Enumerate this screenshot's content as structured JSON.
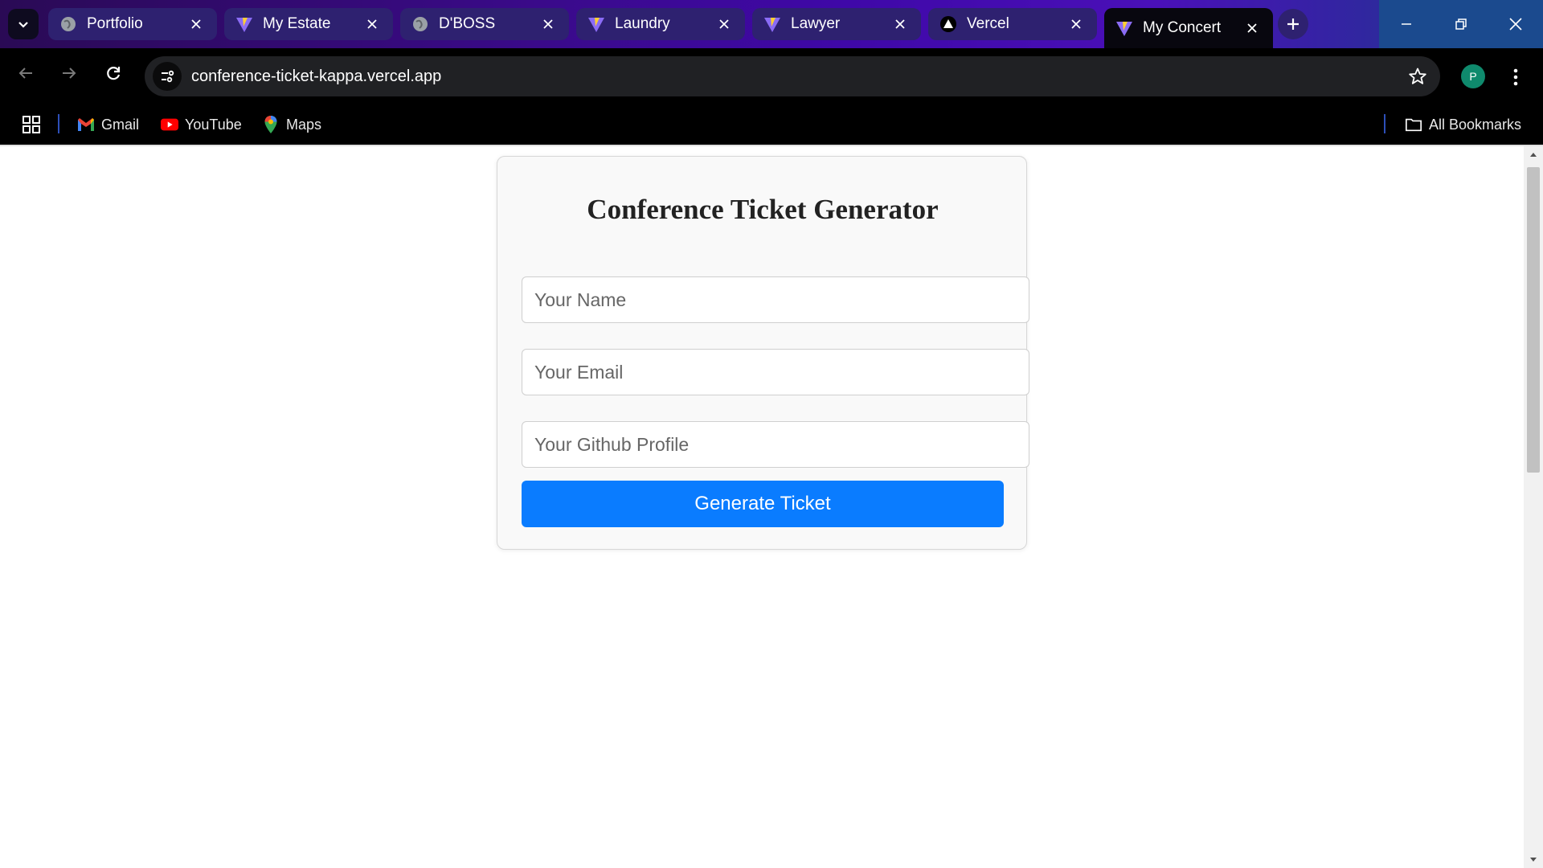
{
  "browser": {
    "tabs": [
      {
        "title": "Portfolio",
        "icon": "globe-icon",
        "active": false
      },
      {
        "title": "My Estate",
        "icon": "vite-icon",
        "active": false
      },
      {
        "title": "D'BOSS",
        "icon": "globe-icon",
        "active": false
      },
      {
        "title": "Laundry",
        "icon": "vite-icon",
        "active": false
      },
      {
        "title": "Lawyer",
        "icon": "vite-icon",
        "active": false
      },
      {
        "title": "Vercel",
        "icon": "vercel-icon",
        "active": false
      },
      {
        "title": "My Concert",
        "icon": "vite-icon",
        "active": true
      }
    ],
    "url": "conference-ticket-kappa.vercel.app",
    "profile_initial": "P",
    "bookmarks": [
      {
        "label": "Gmail",
        "icon": "gmail-icon"
      },
      {
        "label": "YouTube",
        "icon": "youtube-icon"
      },
      {
        "label": "Maps",
        "icon": "maps-icon"
      }
    ],
    "all_bookmarks_label": "All Bookmarks"
  },
  "page": {
    "title": "Conference Ticket Generator",
    "fields": {
      "name_placeholder": "Your Name",
      "email_placeholder": "Your Email",
      "github_placeholder": "Your Github Profile"
    },
    "button_label": "Generate Ticket"
  },
  "colors": {
    "accent_button": "#0a7cff",
    "card_background": "#f9f9f9",
    "browser_frame": "#000000"
  }
}
